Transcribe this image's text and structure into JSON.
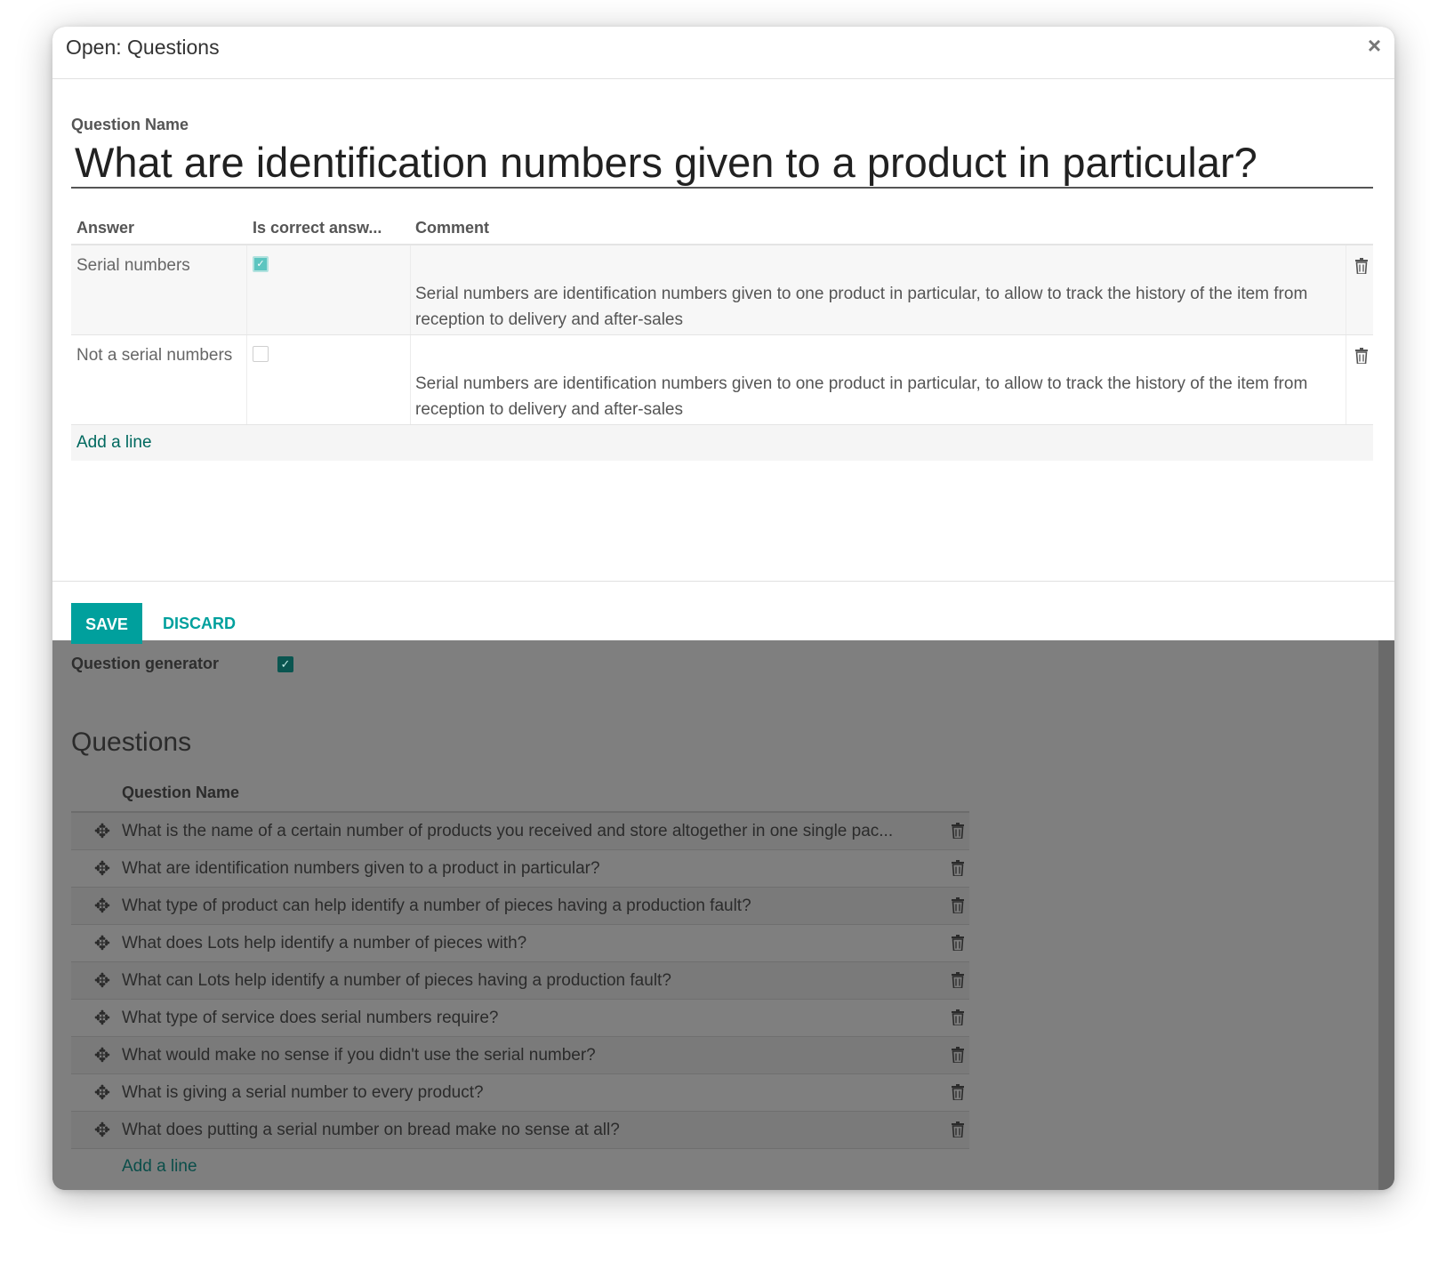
{
  "modal": {
    "title": "Open: Questions",
    "close_symbol": "×",
    "question_label": "Question Name",
    "question_value": "What are identification numbers given to a product in particular?",
    "answers_table": {
      "headers": [
        "Answer",
        "Is correct answ...",
        "Comment"
      ],
      "rows": [
        {
          "answer": "Serial numbers",
          "is_correct": true,
          "comment": "Serial numbers are identification numbers given to one product in particular, to allow to track the history of the item from reception to delivery and after-sales"
        },
        {
          "answer": "Not a serial numbers",
          "is_correct": false,
          "comment": "Serial numbers are identification numbers given to one product in particular, to allow to track the history of the item from reception to delivery and after-sales"
        }
      ],
      "add_line": "Add a line"
    },
    "save_label": "SAVE",
    "discard_label": "DISCARD"
  },
  "background_form": {
    "question_generator_label": "Question generator",
    "question_generator_checked": true,
    "questions_title": "Questions",
    "questions_column": "Question Name",
    "questions": [
      "What is the name of a certain number of products you received and store altogether in one single pac...",
      "What are identification numbers given to a product in particular?",
      "What type of product can help identify a number of pieces having a production fault?",
      "What does Lots help identify a number of pieces with?",
      "What can Lots help identify a number of pieces having a production fault?",
      "What type of service does serial numbers require?",
      "What would make no sense if you didn't use the serial number?",
      "What is giving a serial number to every product?",
      "What does putting a serial number on bread make no sense at all?"
    ],
    "add_line": "Add a line"
  },
  "icons": {
    "close": "close-icon",
    "delete": "trash-icon",
    "drag": "drag-handle-icon",
    "check": "checkmark-icon"
  },
  "colors": {
    "primary": "#00a09d",
    "overlay": "#7f7f7f",
    "link": "#00695f"
  }
}
